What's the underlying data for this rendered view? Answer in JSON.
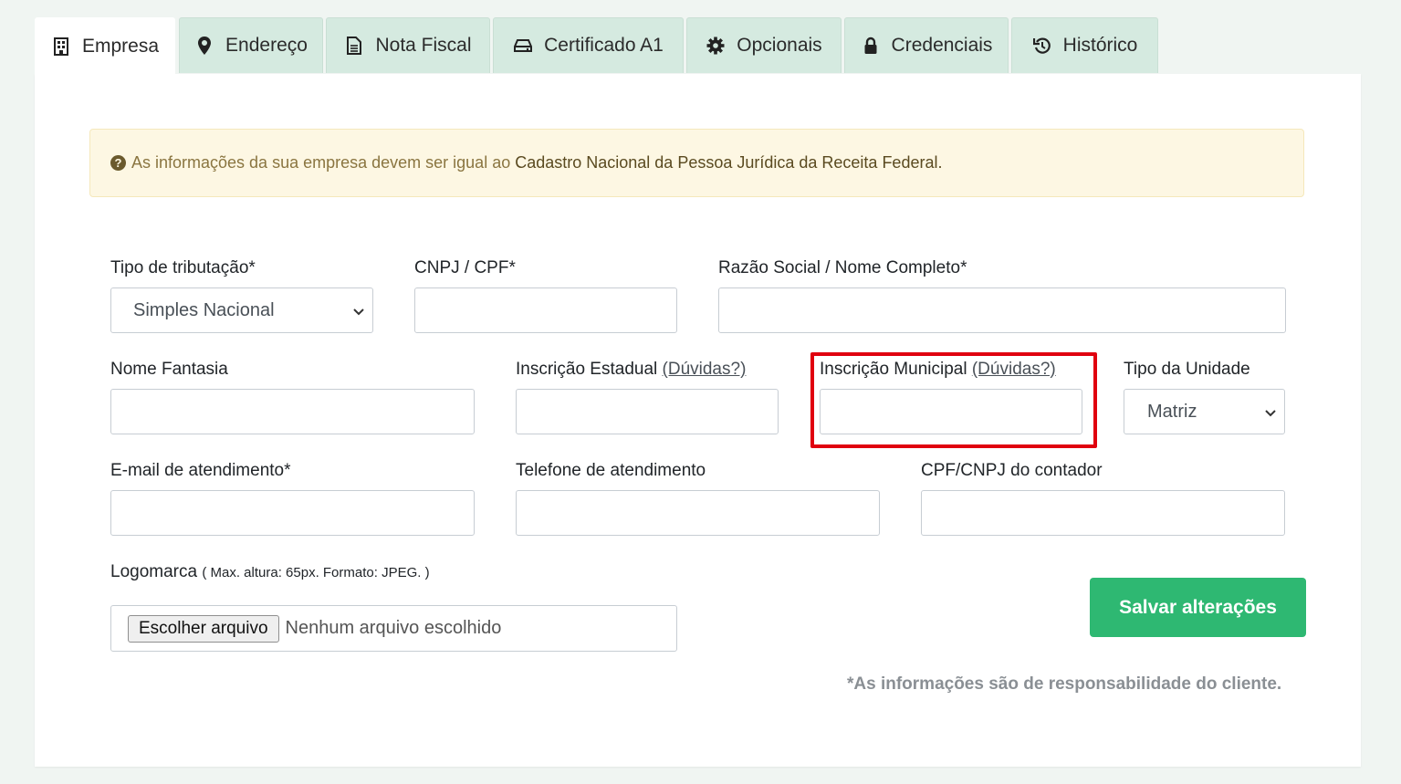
{
  "tabs": [
    {
      "label": "Empresa",
      "icon": "building-icon",
      "active": true
    },
    {
      "label": "Endereço",
      "icon": "map-marker-icon",
      "active": false
    },
    {
      "label": "Nota Fiscal",
      "icon": "file-text-icon",
      "active": false
    },
    {
      "label": "Certificado A1",
      "icon": "hdd-icon",
      "active": false
    },
    {
      "label": "Opcionais",
      "icon": "gear-icon",
      "active": false
    },
    {
      "label": "Credenciais",
      "icon": "lock-icon",
      "active": false
    },
    {
      "label": "Histórico",
      "icon": "history-icon",
      "active": false
    }
  ],
  "alert": {
    "text": "As informações da sua empresa devem ser igual ao",
    "strong": "Cadastro Nacional da Pessoa Jurídica da Receita Federal."
  },
  "form": {
    "tipo_tributacao": {
      "label": "Tipo de tributação*",
      "value": "Simples Nacional"
    },
    "cnpj": {
      "label": "CNPJ / CPF*",
      "value": ""
    },
    "razao_social": {
      "label": "Razão Social / Nome Completo*",
      "value": ""
    },
    "nome_fantasia": {
      "label": "Nome Fantasia",
      "value": ""
    },
    "inscricao_estadual": {
      "label": "Inscrição Estadual",
      "help": "(Dúvidas?)",
      "value": ""
    },
    "inscricao_municipal": {
      "label": "Inscrição Municipal",
      "help": "(Dúvidas?)",
      "value": ""
    },
    "tipo_unidade": {
      "label": "Tipo da Unidade",
      "value": "Matriz"
    },
    "email": {
      "label": "E-mail de atendimento*",
      "value": ""
    },
    "telefone": {
      "label": "Telefone de atendimento",
      "value": ""
    },
    "contador": {
      "label": "CPF/CNPJ do contador",
      "value": ""
    },
    "logomarca": {
      "label": "Logomarca",
      "hint": "( Max. altura: 65px. Formato: JPEG. )",
      "button": "Escolher arquivo",
      "status": "Nenhum arquivo escolhido"
    }
  },
  "save_button": "Salvar alterações",
  "note": "*As informações são de responsabilidade do cliente.",
  "colors": {
    "accent": "#2eb872",
    "highlight": "#e0000f",
    "tab_bg": "#d5eae0",
    "alert_bg": "#fdf7e3"
  }
}
